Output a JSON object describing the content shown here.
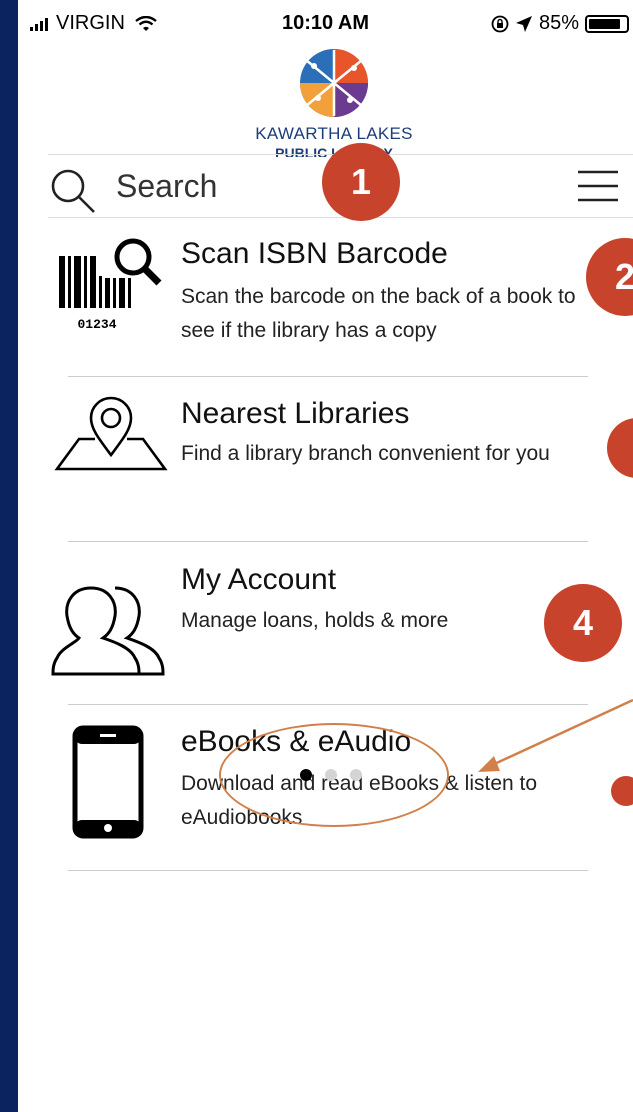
{
  "status_bar": {
    "carrier": "VIRGIN",
    "time": "10:10 AM",
    "battery": "85%"
  },
  "logo": {
    "line1": "KAWARTHA LAKES",
    "line2": "PUBLIC LIBRARY"
  },
  "search": {
    "placeholder": "Search"
  },
  "menu": [
    {
      "title": "Scan ISBN Barcode",
      "description": "Scan the barcode on the back of a book to see if the library has a copy",
      "icon": "barcode-scan-icon",
      "barcode_digits": "01234"
    },
    {
      "title": "Nearest Libraries",
      "description": "Find a library branch convenient for you",
      "icon": "map-pin-icon"
    },
    {
      "title": "My Account",
      "description": "Manage loans, holds & more",
      "icon": "users-icon"
    },
    {
      "title": "eBooks & eAudio",
      "description": "Download and read eBooks & listen to eAudiobooks",
      "icon": "tablet-icon"
    }
  ],
  "badges": [
    "1",
    "2",
    "4"
  ],
  "pager": {
    "pages": 3,
    "current": 1
  },
  "colors": {
    "badge": "#c8432b",
    "annotation": "#d1804b",
    "frame": "#0b2460"
  }
}
